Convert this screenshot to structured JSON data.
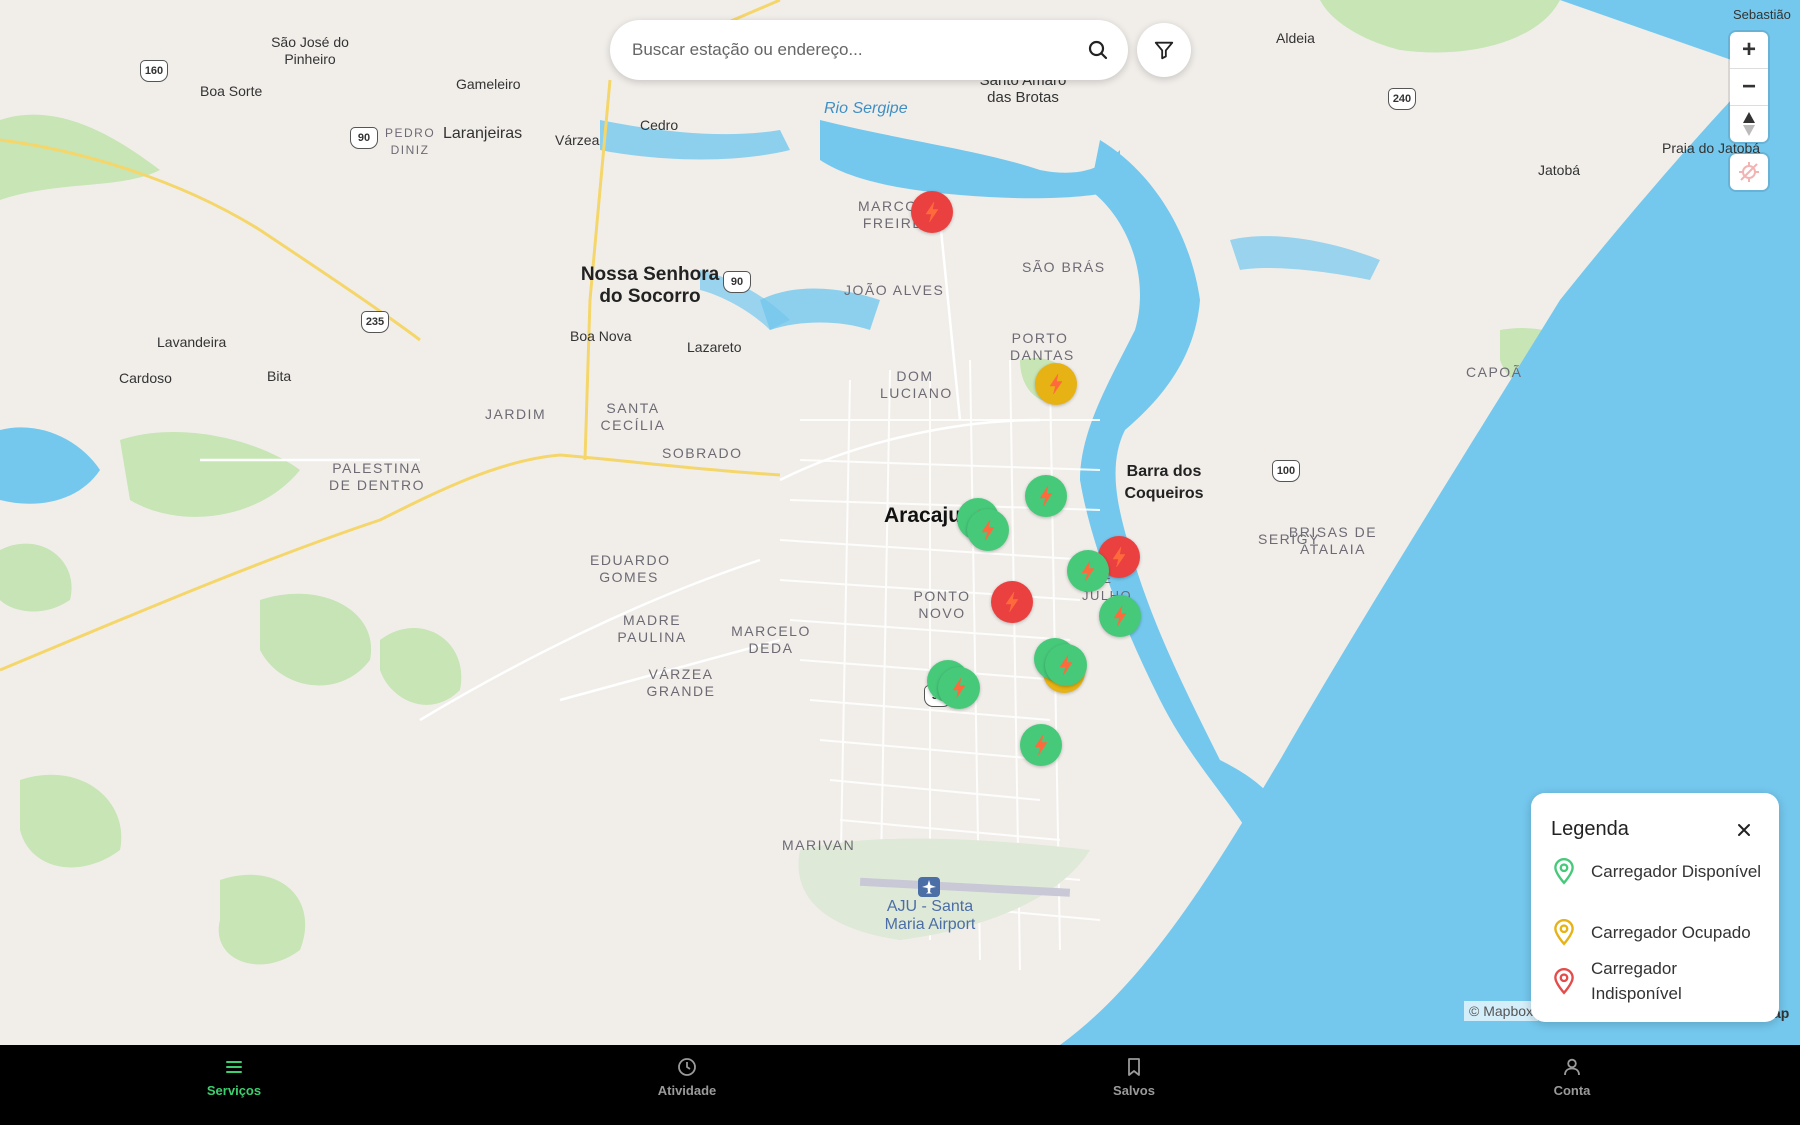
{
  "map": {
    "places": {
      "sao_jose_do_pinheiro": "São José do Pinheiro",
      "boa_sorte": "Boa Sorte",
      "gameleiro": "Gameleiro",
      "laranjeiras": "Laranjeiras",
      "pedro_diniz": "PEDRO DINIZ",
      "varzea": "Várzea",
      "cedro": "Cedro",
      "rio_sergipe": "Rio Sergipe",
      "santo_amaro": "Santo Amaro das Brotas",
      "aldeia": "Aldeia",
      "sao_sebastiao": "Sebastião",
      "praia_do_jatoba": "Praia do Jatobá",
      "jatoba": "Jatobá",
      "marcos_freire": "MARCOS FREIRE",
      "nossa_senhora": "Nossa Senhora do Socorro",
      "joao_alves": "JOÃO ALVES",
      "sao_bras": "SÃO BRÁS",
      "lavandeira": "Lavandeira",
      "cardoso": "Cardoso",
      "bita": "Bita",
      "boa_nova": "Boa Nova",
      "lazareto": "Lazareto",
      "porto_dantas": "PORTO DANTAS",
      "dom_luciano": "DOM LUCIANO",
      "jardim": "JARDIM",
      "santa_cecilia": "SANTA CECÍLIA",
      "sobrado": "SOBRADO",
      "capoa": "CAPOÃ",
      "palestina": "PALESTINA DE DENTRO",
      "aracaju": "Aracaju",
      "barra": "Barra dos Coqueiros",
      "serigy": "SERIGY",
      "brisas": "BRISAS DE ATALAIA",
      "eduardo_gomes": "EDUARDO GOMES",
      "ponto_novo": "PONTO NOVO",
      "treze_julho": "DE JULHO",
      "madre_paulina": "MADRE PAULINA",
      "marcelo_deda": "MARCELO DEDA",
      "varzea_grande": "VÁRZEA GRANDE",
      "marivan": "MARIVAN",
      "airport": "AJU - Santa Maria Airport"
    },
    "shields": [
      "160",
      "90",
      "90",
      "235",
      "240",
      "100",
      "50"
    ],
    "markers": [
      {
        "status": "unavailable",
        "color": "#ea4040"
      },
      {
        "status": "occupied",
        "color": "#e6b214"
      },
      {
        "status": "available",
        "color": "#47c97a"
      },
      {
        "status": "available",
        "color": "#47c97a"
      },
      {
        "status": "available",
        "color": "#47c97a"
      },
      {
        "status": "unavailable",
        "color": "#ea4040"
      },
      {
        "status": "available",
        "color": "#47c97a"
      },
      {
        "status": "unavailable",
        "color": "#ea4040"
      },
      {
        "status": "available",
        "color": "#47c97a"
      },
      {
        "status": "occupied",
        "color": "#e6b214"
      },
      {
        "status": "available",
        "color": "#47c97a"
      },
      {
        "status": "available",
        "color": "#47c97a"
      },
      {
        "status": "available",
        "color": "#47c97a"
      },
      {
        "status": "available",
        "color": "#47c97a"
      },
      {
        "status": "available",
        "color": "#47c97a"
      }
    ]
  },
  "search": {
    "placeholder": "Buscar estação ou endereço...",
    "icon": "search-icon"
  },
  "filter": {
    "icon": "filter-icon"
  },
  "zoom": {
    "in_label": "+",
    "out_label": "−"
  },
  "attribution": {
    "text": "© Mapbox",
    "right_text": "ap"
  },
  "legend": {
    "title": "Legenda",
    "items": [
      {
        "label": "Carregador Disponível",
        "color": "#47c97a"
      },
      {
        "label": "Carregador Ocupado",
        "color": "#e6b214"
      },
      {
        "label": "Carregador Indisponível",
        "color": "#e44c4c"
      }
    ]
  },
  "nav": {
    "items": [
      {
        "label": "Serviços",
        "icon": "menu-icon",
        "active": true
      },
      {
        "label": "Atividade",
        "icon": "clock-icon",
        "active": false
      },
      {
        "label": "Salvos",
        "icon": "bookmark-icon",
        "active": false
      },
      {
        "label": "Conta",
        "icon": "user-icon",
        "active": false
      }
    ],
    "active_color": "#3ccf6e",
    "inactive_color": "#9a9a9a"
  },
  "colors": {
    "water": "#74c8ee",
    "land": "#f1eeea",
    "park": "#b6e2a6",
    "road_major": "#f5d66b"
  }
}
